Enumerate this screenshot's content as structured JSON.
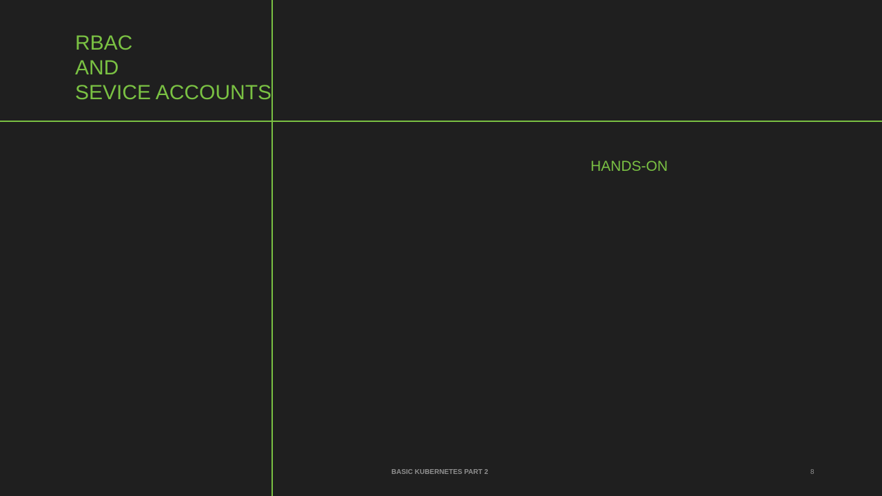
{
  "slide": {
    "title_lines": [
      "RBAC",
      "AND",
      "SEVICE ACCOUNTS"
    ],
    "subtitle": "HANDS-ON",
    "footer": "BASIC KUBERNETES PART 2",
    "page_number": "8"
  },
  "colors": {
    "background": "#1f1f1f",
    "accent": "#7ac143",
    "footer_text": "#8f8f8f"
  }
}
